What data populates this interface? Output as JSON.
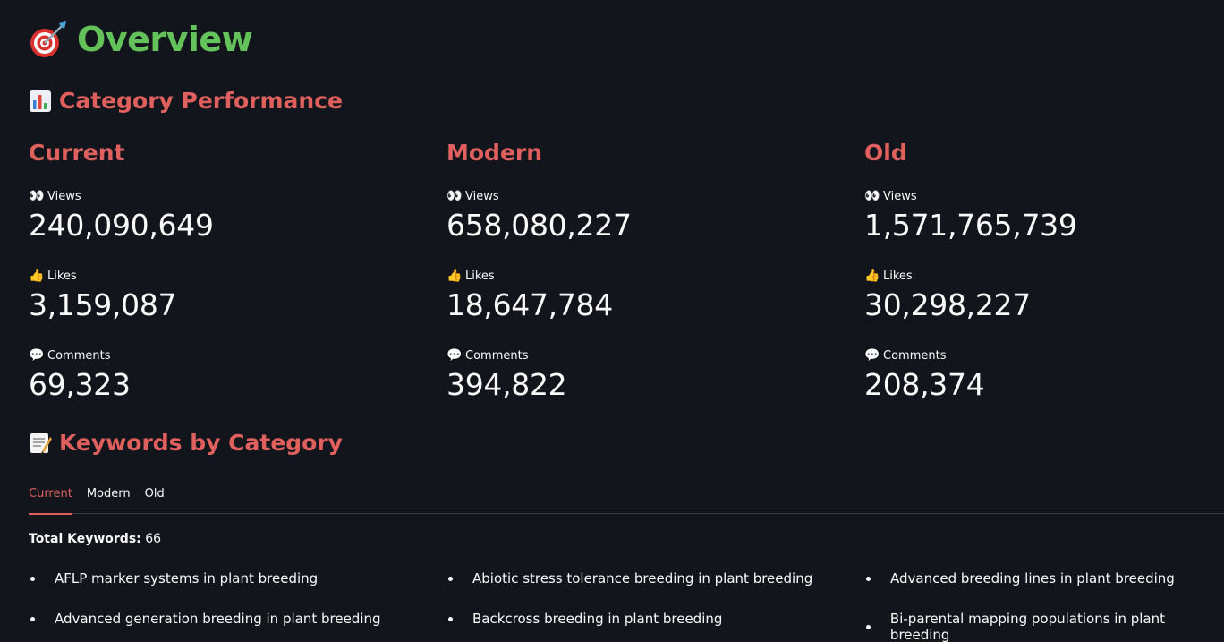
{
  "header": {
    "title": "Overview",
    "icon": "dart-target-icon"
  },
  "sections": {
    "category_performance": {
      "title": "Category Performance",
      "icon": "bar-chart-icon"
    },
    "keywords": {
      "title": "Keywords by Category",
      "icon": "memo-icon"
    }
  },
  "metric_icons": {
    "views": "👀",
    "likes": "👍",
    "comments": "💬"
  },
  "categories": [
    {
      "name": "Current",
      "views_label": "Views",
      "views": "240,090,649",
      "likes_label": "Likes",
      "likes": "3,159,087",
      "comments_label": "Comments",
      "comments": "69,323"
    },
    {
      "name": "Modern",
      "views_label": "Views",
      "views": "658,080,227",
      "likes_label": "Likes",
      "likes": "18,647,784",
      "comments_label": "Comments",
      "comments": "394,822"
    },
    {
      "name": "Old",
      "views_label": "Views",
      "views": "1,571,765,739",
      "likes_label": "Likes",
      "likes": "30,298,227",
      "comments_label": "Comments",
      "comments": "208,374"
    }
  ],
  "tabs": [
    {
      "label": "Current",
      "active": true
    },
    {
      "label": "Modern",
      "active": false
    },
    {
      "label": "Old",
      "active": false
    }
  ],
  "total_keywords": {
    "label": "Total Keywords:",
    "value": "66"
  },
  "keywords": [
    "AFLP marker systems in plant breeding",
    "Abiotic stress tolerance breeding in plant breeding",
    "Advanced breeding lines in plant breeding",
    "Advanced generation breeding in plant breeding",
    "Backcross breeding in plant breeding",
    "Bi-parental mapping populations in plant breeding"
  ],
  "colors": {
    "background": "#13151c",
    "accent_red": "#e0605e",
    "title_green": "#64c25a",
    "text": "#fafafa"
  }
}
